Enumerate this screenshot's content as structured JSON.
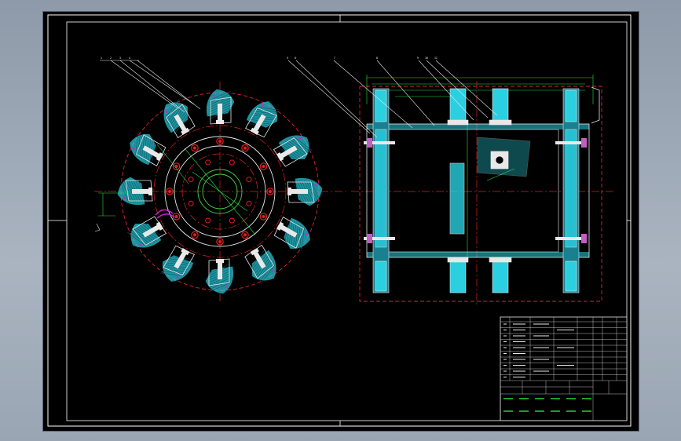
{
  "colors": {
    "background": "#000000",
    "border": "#ffffff",
    "outline": "#e8e8e8",
    "hatch": "#2ad0e0",
    "centerline": "#e02020",
    "dimension": "#28e040",
    "accent": "#d020d0"
  },
  "front_view": {
    "leader_labels": [
      "1",
      "2",
      "3",
      "4"
    ],
    "blade_count": 12,
    "bolt_holes_outer": 12,
    "bolt_holes_inner": 8
  },
  "side_view": {
    "leader_labels": [
      "5",
      "6",
      "7",
      "8",
      "9",
      "10",
      "11"
    ]
  },
  "title_block": {
    "name": "",
    "scale": "",
    "sheet": ""
  }
}
